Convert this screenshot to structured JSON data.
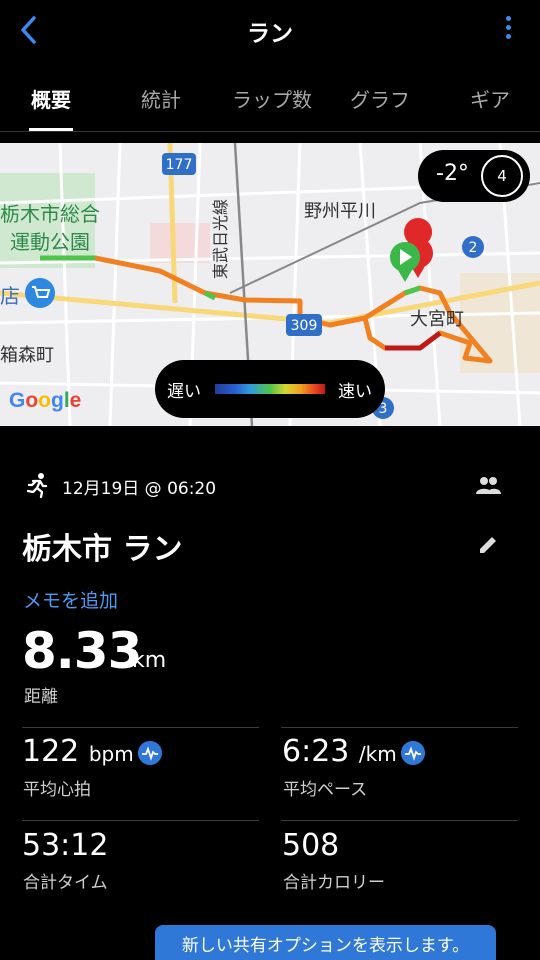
{
  "header": {
    "title": "ラン"
  },
  "tabs": [
    "概要",
    "統計",
    "ラップ数",
    "グラフ",
    "ギア"
  ],
  "map": {
    "temperature": "-2°",
    "wind_speed": "4",
    "legend_slow": "遅い",
    "legend_fast": "速い",
    "labels": {
      "park_line1": "栃木市総合",
      "park_line2": "運動公園",
      "railway": "東武日光線",
      "station_area": "野州平川",
      "town": "大宮町",
      "hakomori": "箱森町",
      "shop_fragment": "店",
      "route_177": "177",
      "route_309": "309",
      "route_2": "2",
      "route_3": "3"
    },
    "attribution": "Google"
  },
  "activity": {
    "date": "12月19日 @ 06:20",
    "title": "栃木市 ラン",
    "memo": "メモを追加",
    "distance": "8.33",
    "distance_unit": "km",
    "distance_label": "距離"
  },
  "stats": [
    {
      "value": "122",
      "unit": "bpm",
      "label": "平均心拍"
    },
    {
      "value": "6:23",
      "unit": "/km",
      "label": "平均ペース"
    },
    {
      "value": "53:12",
      "unit": "",
      "label": "合計タイム"
    },
    {
      "value": "508",
      "unit": "",
      "label": "合計カロリー"
    }
  ],
  "share_banner": "新しい共有オプションを表示します。",
  "colors": {
    "accent": "#2f78d8",
    "link": "#4e9af0",
    "start_marker": "#3cb84a",
    "end_marker": "#e02828"
  }
}
